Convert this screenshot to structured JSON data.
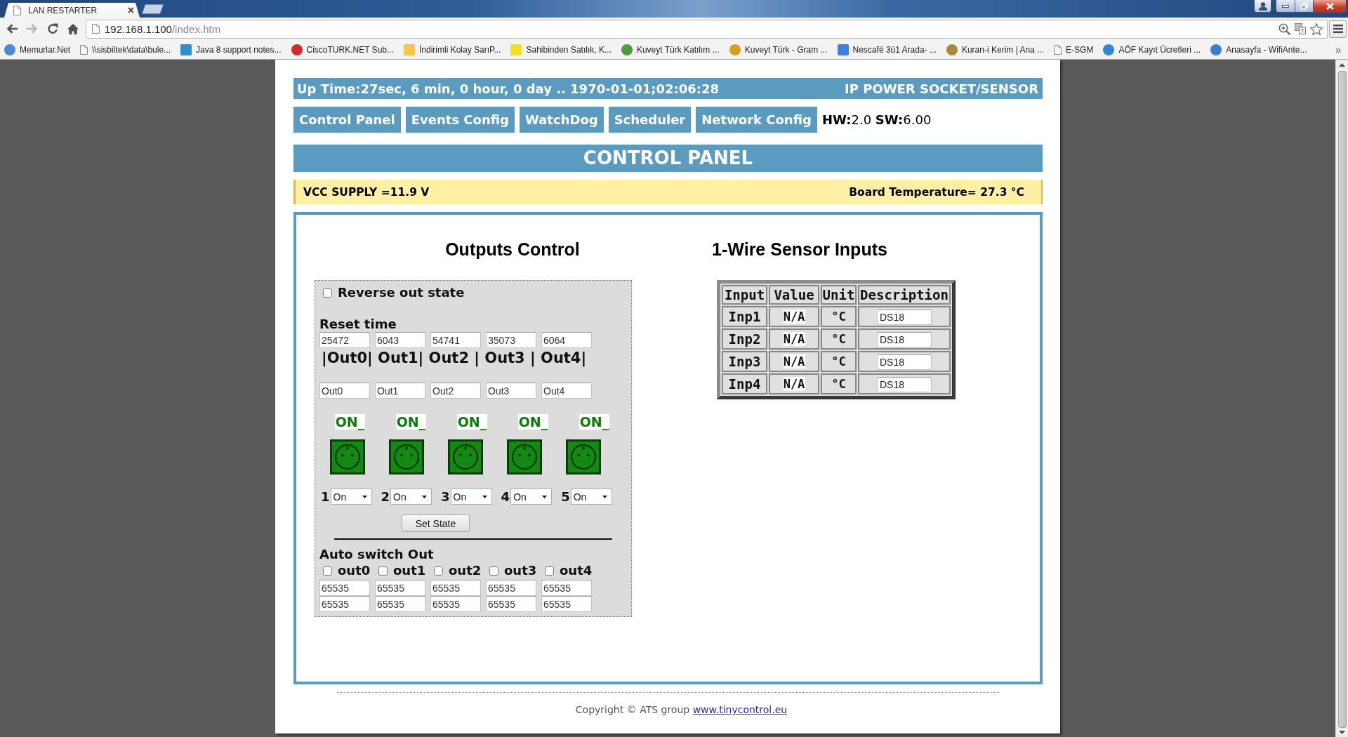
{
  "browser": {
    "tabs": [
      {
        "title": "LAN RESTARTER",
        "selected": true
      }
    ],
    "address": {
      "host": "192.168.1.100",
      "path": "/index.htm"
    },
    "bookmarks": [
      {
        "label": "Memurlar.Net",
        "kind": "round",
        "color": "#4a8ad0"
      },
      {
        "label": "\\\\sisbiltek\\data\\bule...",
        "kind": "page"
      },
      {
        "label": "Java 8 support notes...",
        "kind": "square",
        "color": "#2b8fd6"
      },
      {
        "label": "CiscoTURK.NET Sub...",
        "kind": "round",
        "color": "#d42a2a"
      },
      {
        "label": "İndirimli Kolay SarıP...",
        "kind": "square",
        "color": "#f2c94c"
      },
      {
        "label": "Sahibinden Satılık, K...",
        "kind": "square",
        "color": "#f4e01c"
      },
      {
        "label": "Kuveyt Türk Katılım ...",
        "kind": "round",
        "color": "#4f9a3a"
      },
      {
        "label": "Kuveyt Türk - Gram ...",
        "kind": "round",
        "color": "#d4a020"
      },
      {
        "label": "Nescafé 3ü1 Arada- ...",
        "kind": "square",
        "color": "#3b82e6"
      },
      {
        "label": "Kuran-i Kerim | Ana ...",
        "kind": "round",
        "color": "#a88a3c"
      },
      {
        "label": "E-SGM",
        "kind": "page"
      },
      {
        "label": "AÖF Kayıt Ücretleri ...",
        "kind": "round",
        "color": "#2f86d6"
      },
      {
        "label": "Anasayfa - WifiAnte...",
        "kind": "round",
        "color": "#3a7fd0"
      }
    ],
    "bookmarks_overflow": "»"
  },
  "page": {
    "header": {
      "uptime": "Up Time:27sec, 6 min, 0 hour, 0 day .. 1970-01-01;02:06:28",
      "product": "IP POWER SOCKET/SENSOR"
    },
    "nav": [
      "Control Panel",
      "Events Config",
      "WatchDog",
      "Scheduler",
      "Network Config"
    ],
    "versions": "**HW:**2.0 **SW:**6.00",
    "title": "CONTROL PANEL",
    "status": {
      "supply": "VCC SUPPLY =11.9 V",
      "temperature": "Board Temperature= 27.3 °C"
    },
    "outputs": {
      "heading": "Outputs Control",
      "reverse": {
        "label": "Reverse out state",
        "checked": false
      },
      "reset_label": "Reset time",
      "channel_labels": "|Out0| Out1| Out2 | Out3 | Out4|",
      "channels": [
        {
          "reset_time": "25472",
          "name": "Out0",
          "status": "ON_",
          "on": true,
          "number": "1",
          "mode": "On"
        },
        {
          "reset_time": "6043",
          "name": "Out1",
          "status": "ON_",
          "on": true,
          "number": "2",
          "mode": "On"
        },
        {
          "reset_time": "54741",
          "name": "Out2",
          "status": "ON_",
          "on": true,
          "number": "3",
          "mode": "On"
        },
        {
          "reset_time": "35073",
          "name": "Out3",
          "status": "ON_",
          "on": true,
          "number": "4",
          "mode": "On"
        },
        {
          "reset_time": "6064",
          "name": "Out4",
          "status": "ON_",
          "on": true,
          "number": "5",
          "mode": "On"
        }
      ],
      "set_button": "Set State",
      "auto_switch": {
        "label": "Auto switch Out",
        "channels": [
          {
            "label": "out0",
            "checked": false,
            "values": [
              "65535",
              "65535"
            ]
          },
          {
            "label": "out1",
            "checked": false,
            "values": [
              "65535",
              "65535"
            ]
          },
          {
            "label": "out2",
            "checked": false,
            "values": [
              "65535",
              "65535"
            ]
          },
          {
            "label": "out3",
            "checked": false,
            "values": [
              "65535",
              "65535"
            ]
          },
          {
            "label": "out4",
            "checked": false,
            "values": [
              "65535",
              "65535"
            ]
          }
        ]
      }
    },
    "sensors": {
      "heading": "1-Wire Sensor Inputs",
      "columns": [
        "Input",
        "Value",
        "Unit",
        "Description"
      ],
      "rows": [
        {
          "input": "Inp1",
          "value": "N/A",
          "unit": "°C",
          "description": "DS18"
        },
        {
          "input": "Inp2",
          "value": "N/A",
          "unit": "°C",
          "description": "DS18"
        },
        {
          "input": "Inp3",
          "value": "N/A",
          "unit": "°C",
          "description": "DS18"
        },
        {
          "input": "Inp4",
          "value": "N/A",
          "unit": "°C",
          "description": "DS18"
        }
      ]
    },
    "footer": {
      "copyright": "Copyright © ATS group",
      "link": "www.tinycontrol.eu"
    }
  }
}
